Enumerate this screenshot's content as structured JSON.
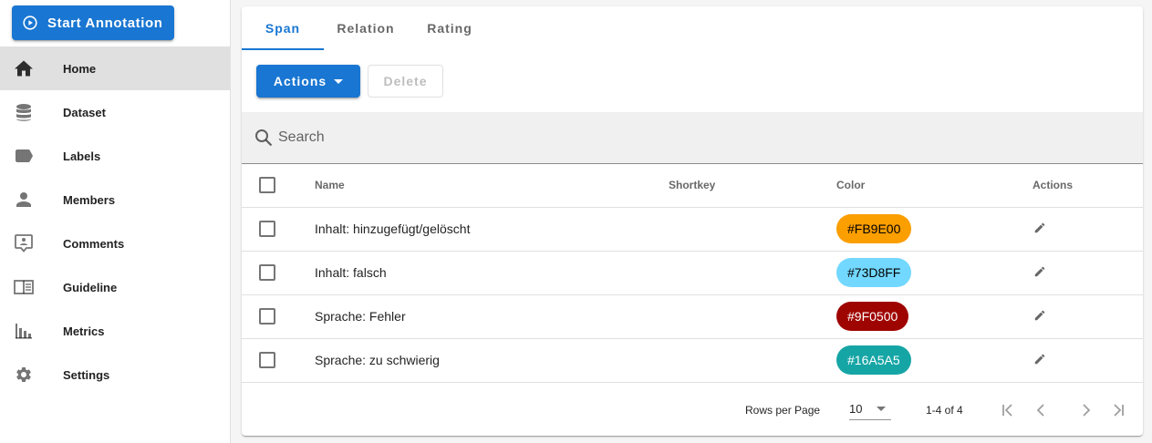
{
  "sidebar": {
    "start_button": "Start Annotation",
    "items": [
      {
        "label": "Home",
        "icon": "home-icon",
        "active": true
      },
      {
        "label": "Dataset",
        "icon": "database-icon"
      },
      {
        "label": "Labels",
        "icon": "label-icon"
      },
      {
        "label": "Members",
        "icon": "person-icon"
      },
      {
        "label": "Comments",
        "icon": "comment-icon"
      },
      {
        "label": "Guideline",
        "icon": "book-icon"
      },
      {
        "label": "Metrics",
        "icon": "chart-icon"
      },
      {
        "label": "Settings",
        "icon": "gear-icon"
      }
    ]
  },
  "tabs": [
    "Span",
    "Relation",
    "Rating"
  ],
  "toolbar": {
    "actions_label": "Actions",
    "delete_label": "Delete"
  },
  "search": {
    "placeholder": "Search"
  },
  "table": {
    "headers": {
      "name": "Name",
      "shortkey": "Shortkey",
      "color": "Color",
      "actions": "Actions"
    },
    "rows": [
      {
        "name": "Inhalt: hinzugefügt/gelöscht",
        "shortkey": "",
        "color": "#FB9E00",
        "text_color": "#000000"
      },
      {
        "name": "Inhalt: falsch",
        "shortkey": "",
        "color": "#73D8FF",
        "text_color": "#000000"
      },
      {
        "name": "Sprache: Fehler",
        "shortkey": "",
        "color": "#9F0500",
        "text_color": "#ffffff"
      },
      {
        "name": "Sprache: zu schwierig",
        "shortkey": "",
        "color": "#16A5A5",
        "text_color": "#ffffff"
      }
    ]
  },
  "footer": {
    "rows_per_page_label": "Rows per Page",
    "rows_per_page": "10",
    "range": "1-4 of 4"
  },
  "colors": {
    "primary": "#1976d2"
  }
}
